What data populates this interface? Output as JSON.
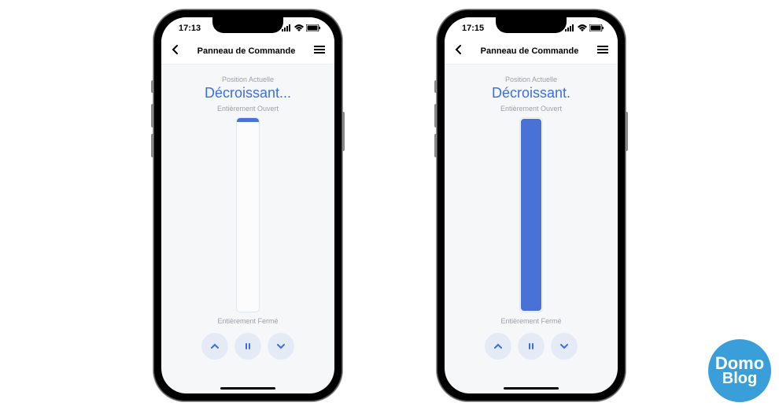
{
  "phones": [
    {
      "time": "17:13",
      "header_title": "Panneau de Commande",
      "position_label": "Position Actuelle",
      "status_text": "Décroissant...",
      "top_label": "Entièrement Ouvert",
      "bottom_label": "Entièrement Fermé",
      "fill_percent": 2
    },
    {
      "time": "17:15",
      "header_title": "Panneau de Commande",
      "position_label": "Position Actuelle",
      "status_text": "Décroissant.",
      "top_label": "Entièrement Ouvert",
      "bottom_label": "Entièrement Fermé",
      "fill_percent": 100
    }
  ],
  "logo": {
    "line1": "Domo",
    "line2": "Blog"
  }
}
